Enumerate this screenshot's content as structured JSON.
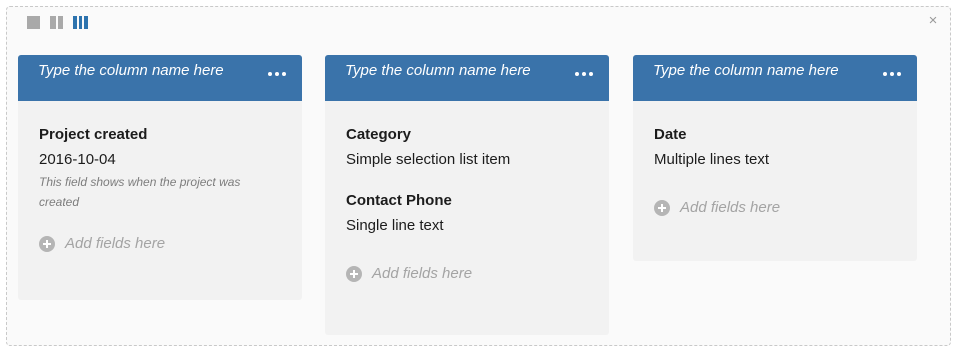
{
  "toolbar": {
    "layouts": [
      {
        "name": "one-column",
        "icon": "single-column-layout-icon",
        "active": false
      },
      {
        "name": "two-columns",
        "icon": "two-column-layout-icon",
        "active": false
      },
      {
        "name": "three-columns",
        "icon": "three-column-layout-icon",
        "active": true
      }
    ],
    "close_label": "×"
  },
  "colors": {
    "header": "#3a73aa",
    "active_layout": "#2d73ae",
    "column_bg": "#f2f2f2"
  },
  "columns": [
    {
      "title": "Type the column name here",
      "menu_icon": "more-dots-icon",
      "fields": [
        {
          "name": "Project created",
          "value": "2016-10-04",
          "help": "This field shows when the project was created"
        }
      ],
      "add_label": "Add fields here"
    },
    {
      "title": "Type the column name here",
      "menu_icon": "more-dots-icon",
      "fields": [
        {
          "name": "Category",
          "value": "Simple selection list item"
        },
        {
          "name": "Contact Phone",
          "value": "Single line text"
        }
      ],
      "add_label": "Add fields here"
    },
    {
      "title": "Type the column name here",
      "menu_icon": "more-dots-icon",
      "fields": [
        {
          "name": "Date",
          "value": "Multiple lines text"
        }
      ],
      "add_label": "Add fields here"
    }
  ]
}
